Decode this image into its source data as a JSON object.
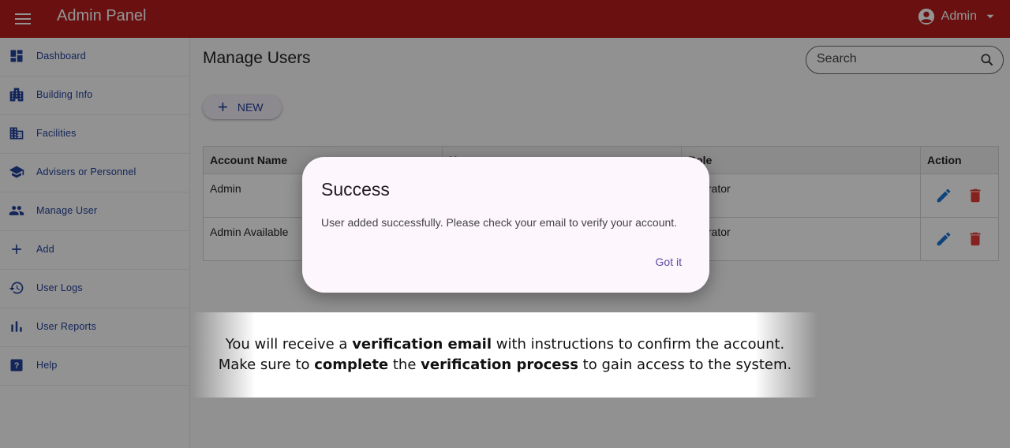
{
  "app": {
    "title": "Admin Panel",
    "user_label": "Admin"
  },
  "colors": {
    "brand": "#b71c1c",
    "accent": "#21409a",
    "danger": "#e53935",
    "edit": "#1976d2"
  },
  "sidebar": {
    "items": [
      {
        "label": "Dashboard",
        "icon": "dashboard-icon"
      },
      {
        "label": "Building Info",
        "icon": "building-icon"
      },
      {
        "label": "Facilities",
        "icon": "facilities-icon"
      },
      {
        "label": "Advisers or Personnel",
        "icon": "school-icon"
      },
      {
        "label": "Manage User",
        "icon": "people-icon"
      },
      {
        "label": "Add",
        "icon": "plus-icon"
      },
      {
        "label": "User Logs",
        "icon": "history-icon"
      },
      {
        "label": "User Reports",
        "icon": "bar-chart-icon"
      },
      {
        "label": "Help",
        "icon": "help-icon"
      }
    ]
  },
  "main": {
    "title": "Manage Users",
    "search_placeholder": "Search",
    "new_label": "NEW",
    "table": {
      "headers": [
        "Account Name",
        "U",
        "Role",
        "Action"
      ],
      "rows": [
        {
          "account": "Admin",
          "username": "",
          "role": "inistrator"
        },
        {
          "account": "Admin Available",
          "username": "",
          "role": "inistrator"
        }
      ]
    }
  },
  "dialog": {
    "title": "Success",
    "message": "User added successfully. Please check your email to verify your account.",
    "button": "Got it"
  },
  "caption": {
    "l1_a": "You will receive a ",
    "l1_b": "verification email",
    "l1_c": " with instructions to confirm the account.",
    "l2_a": "Make sure to ",
    "l2_b": "complete",
    "l2_c": " the ",
    "l2_d": "verification process",
    "l2_e": " to gain access to the system."
  }
}
